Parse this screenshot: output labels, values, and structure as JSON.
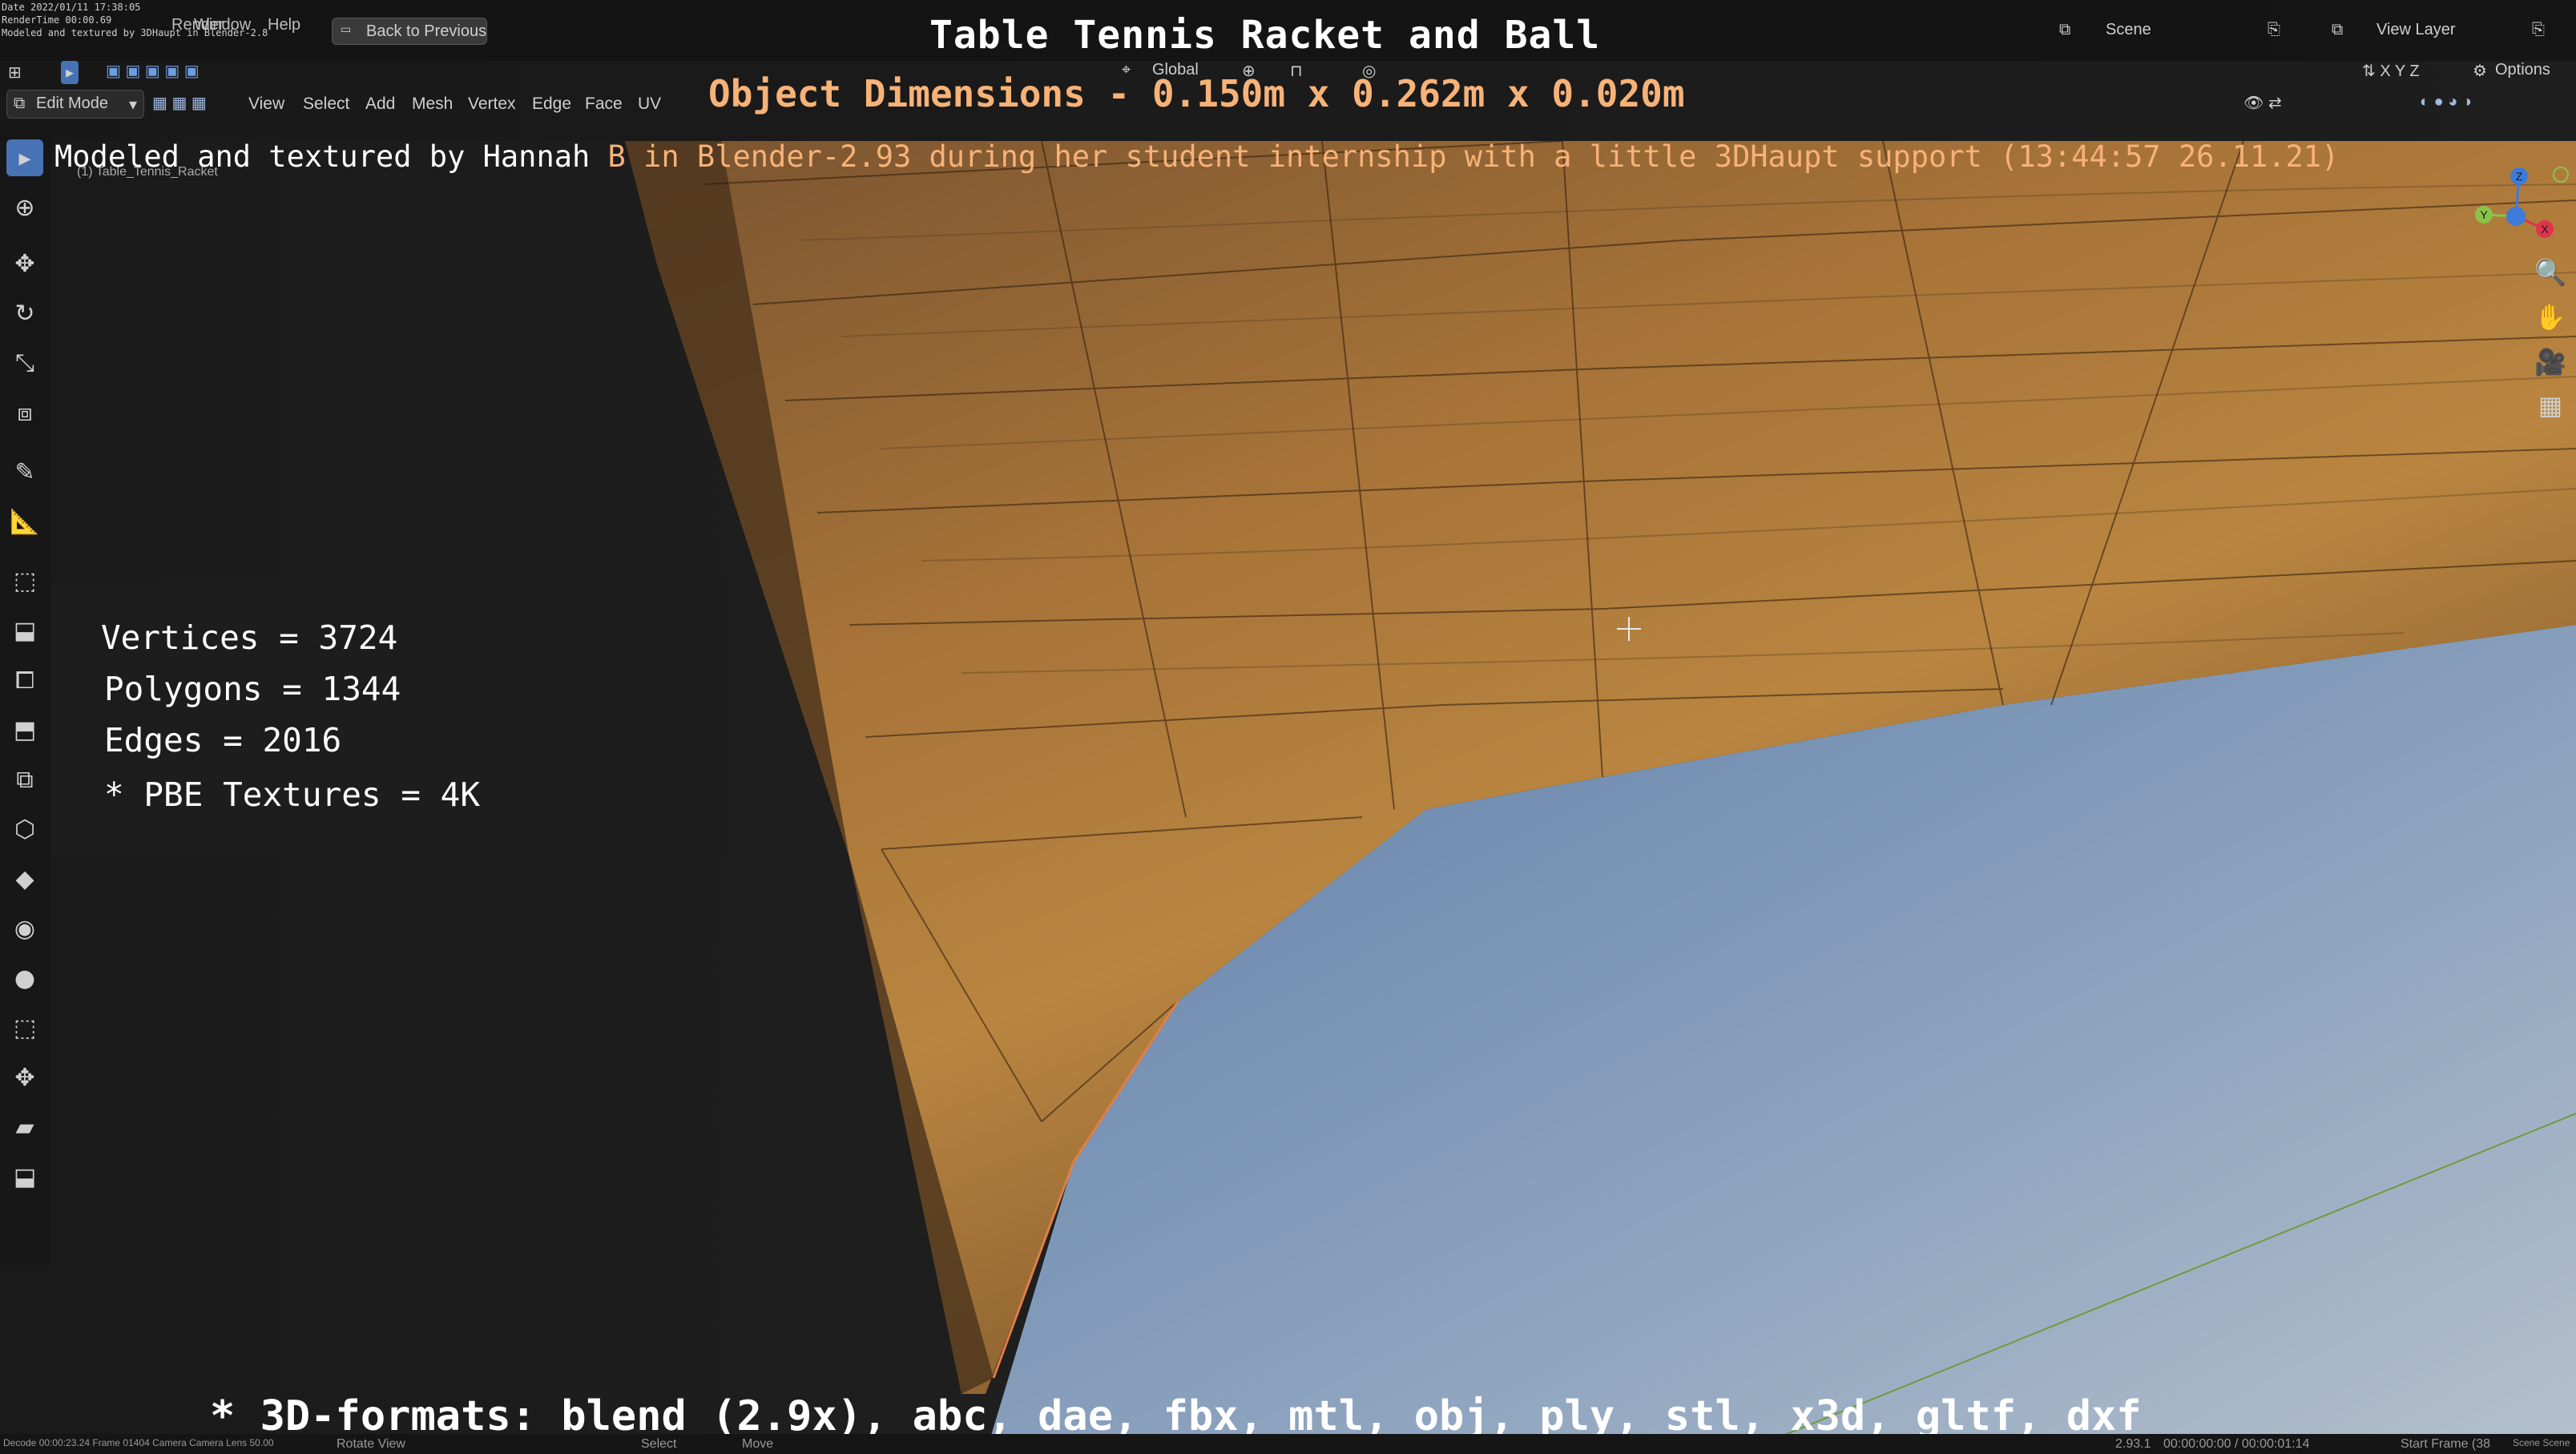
{
  "overlay": {
    "title": "Table Tennis Racket and Ball",
    "dimensions": "Object Dimensions -  0.150m x 0.262m x 0.020m",
    "credit_white": "Modeled and textured by Hannah",
    "credit_orange": " B in Blender-2.93 during her student internship with a little 3DHaupt support (13:44:57 26.11.21)",
    "formats": "* 3D-formats: blend (2.9x), abc, dae, fbx, mtl, obj, ply, stl, x3d, gltf, dxf"
  },
  "stats": {
    "vertices": "Vertices = 3724",
    "polygons": "Polygons = 1344",
    "edges": "Edges = 2016",
    "textures": "* PBE Textures = 4K"
  },
  "topbar": {
    "menus": [
      "Render",
      "Window",
      "Help"
    ],
    "back_button": "Back to Previous",
    "scene_label": "Scene",
    "view_layer_label": "View Layer",
    "render_info_line1": "Date 2022/01/11 17:38:05",
    "render_info_line2": "RenderTime 00:00.69",
    "render_info_line3": "Modeled and textured by 3DHaupt in Blender-2.8"
  },
  "toolbar": {
    "transform_orientation": "Global",
    "options_label": "Options"
  },
  "header": {
    "mode": "Edit Mode",
    "menus": [
      "View",
      "Select",
      "Add",
      "Mesh",
      "Vertex",
      "Edge",
      "Face",
      "UV"
    ],
    "object_name": "(1) Table_Tennis_Racket"
  },
  "axes": {
    "x": "X",
    "y": "Y",
    "z": "Z",
    "x_color": "#e0334c",
    "y_color": "#8bc34a",
    "z_color": "#3d7bd9"
  },
  "status": {
    "left": "Decode 00:00:23.24  Frame 01404  Camera Camera  Lens 50.00",
    "select": "Select",
    "move": "Move",
    "rotate": "Rotate View",
    "version": "2.93.1",
    "frame": "00:00:00:00 / 00:00:01:14",
    "start_frame": "Start Frame (38",
    "scene": "Scene Scene"
  },
  "colors": {
    "racket_wood": "#b07a3d",
    "sky": "#7f98b8",
    "accent_blue": "#4772b3",
    "orange_text": "#f7b278"
  }
}
